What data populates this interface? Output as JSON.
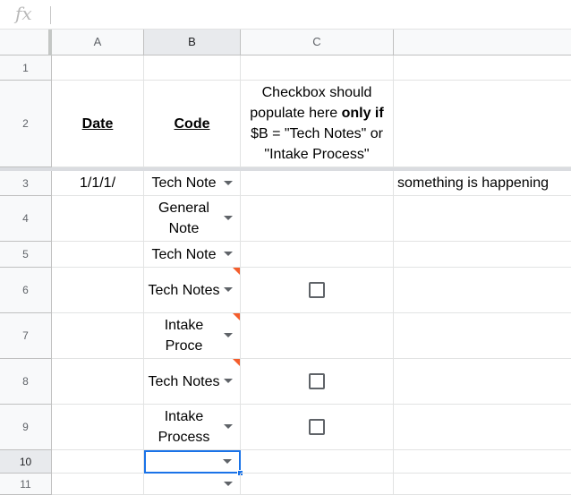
{
  "formula_bar": {
    "fx_label": "fx",
    "value": ""
  },
  "columns": [
    "A",
    "B",
    "C",
    ""
  ],
  "rows": [
    "1",
    "2",
    "3",
    "4",
    "5",
    "6",
    "7",
    "8",
    "9",
    "10",
    "11"
  ],
  "header_row": {
    "date": "Date",
    "code": "Code",
    "note_prefix": "Checkbox should populate here ",
    "note_bold": "only if",
    "note_suffix": " $B = \"Tech Notes\" or \"Intake Process\""
  },
  "data_rows": [
    {
      "row": "3",
      "date": "1/1/1/",
      "code": "Tech Note",
      "checkbox": false,
      "flag": false,
      "extra": "something is happening"
    },
    {
      "row": "4",
      "date": "",
      "code": "General Note",
      "checkbox": false,
      "flag": false,
      "extra": ""
    },
    {
      "row": "5",
      "date": "",
      "code": "Tech Note",
      "checkbox": false,
      "flag": false,
      "extra": ""
    },
    {
      "row": "6",
      "date": "",
      "code": "Tech Notes",
      "checkbox": true,
      "checked": false,
      "flag": true,
      "extra": ""
    },
    {
      "row": "7",
      "date": "",
      "code": "Intake Proce",
      "checkbox": false,
      "flag": true,
      "extra": ""
    },
    {
      "row": "8",
      "date": "",
      "code": "Tech Notes",
      "checkbox": true,
      "checked": false,
      "flag": true,
      "extra": ""
    },
    {
      "row": "9",
      "date": "",
      "code": "Intake Process",
      "checkbox": true,
      "checked": false,
      "flag": false,
      "extra": ""
    },
    {
      "row": "10",
      "date": "",
      "code": "",
      "checkbox": false,
      "flag": false,
      "extra": ""
    },
    {
      "row": "11",
      "date": "",
      "code": "",
      "checkbox": false,
      "flag": false,
      "extra": ""
    }
  ],
  "selection": {
    "column": "B",
    "row": "10"
  },
  "colors": {
    "accent": "#1a73e8",
    "error_flag": "#f45d2c"
  }
}
